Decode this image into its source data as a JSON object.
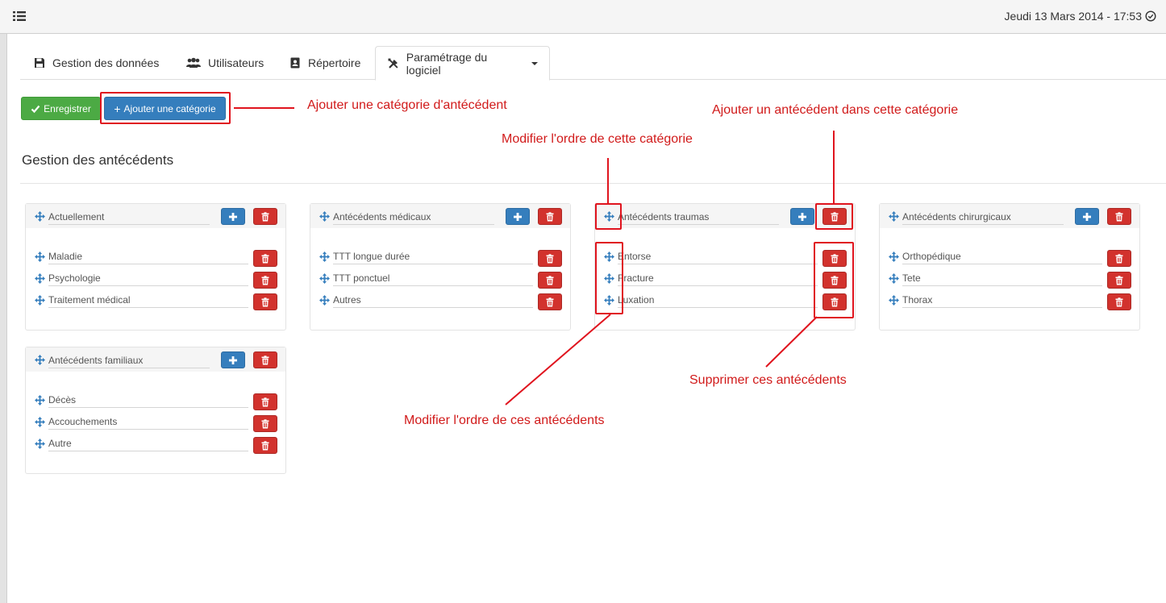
{
  "header": {
    "datetime": "Jeudi 13 Mars 2014 - 17:53"
  },
  "tabs": [
    {
      "label": "Gestion des données",
      "icon": "floppy-icon"
    },
    {
      "label": "Utilisateurs",
      "icon": "users-icon"
    },
    {
      "label": "Répertoire",
      "icon": "address-book-icon"
    },
    {
      "label": "Paramétrage du logiciel",
      "icon": "tools-icon"
    }
  ],
  "toolbar": {
    "save_label": "Enregistrer",
    "add_category_label": "Ajouter une catégorie"
  },
  "section": {
    "title": "Gestion des antécédents"
  },
  "categories": [
    {
      "name": "Actuellement",
      "items": [
        "Maladie",
        "Psychologie",
        "Traitement médical"
      ]
    },
    {
      "name": "Antécédents médicaux",
      "items": [
        "TTT longue durée",
        "TTT ponctuel",
        "Autres"
      ]
    },
    {
      "name": "Antécédents traumas",
      "items": [
        "Entorse",
        "Fracture",
        "Luxation"
      ]
    },
    {
      "name": "Antécédents chirurgicaux",
      "items": [
        "Orthopédique",
        "Tete",
        "Thorax"
      ]
    },
    {
      "name": "Antécédents familiaux",
      "items": [
        "Décès",
        "Accouchements",
        "Autre"
      ]
    }
  ],
  "annotations": {
    "add_category": "Ajouter une catégorie d'antécédent",
    "add_item": "Ajouter un antécédent dans cette catégorie",
    "reorder_category": "Modifier l'ordre de cette catégorie",
    "delete_items": "Supprimer ces antécédents",
    "reorder_items": "Modifier l'ordre de ces antécédents"
  },
  "colors": {
    "annotation": "#d11a1a",
    "primary": "#357ebd",
    "danger": "#d2322d",
    "success": "#4caa44"
  }
}
